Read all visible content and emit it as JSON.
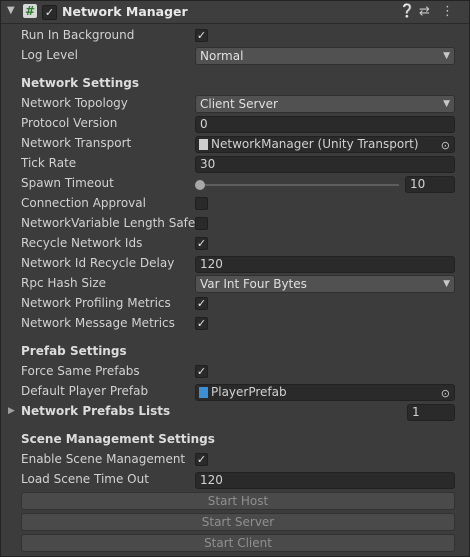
{
  "header": {
    "title": "Network Manager",
    "component_icon": "network-manager-icon",
    "enabled": true,
    "icons": [
      "help-icon",
      "preset-icon",
      "more-menu-icon"
    ]
  },
  "fields": {
    "run_in_background": {
      "label": "Run In Background",
      "checked": true
    },
    "log_level": {
      "label": "Log Level",
      "value": "Normal"
    }
  },
  "network_settings": {
    "heading": "Network Settings",
    "topology": {
      "label": "Network Topology",
      "value": "Client Server"
    },
    "protocol_version": {
      "label": "Protocol Version",
      "value": "0"
    },
    "transport": {
      "label": "Network Transport",
      "value": "NetworkManager (Unity Transport)"
    },
    "tick_rate": {
      "label": "Tick Rate",
      "value": "30"
    },
    "spawn_timeout": {
      "label": "Spawn Timeout",
      "value": "10"
    },
    "connection_approval": {
      "label": "Connection Approval",
      "checked": false
    },
    "nv_length_safety": {
      "label": "NetworkVariable Length Safety",
      "checked": false
    },
    "recycle_ids": {
      "label": "Recycle Network Ids",
      "checked": true
    },
    "recycle_delay": {
      "label": "Network Id Recycle Delay",
      "value": "120"
    },
    "rpc_hash_size": {
      "label": "Rpc Hash Size",
      "value": "Var Int Four Bytes"
    },
    "profiling_metrics": {
      "label": "Network Profiling Metrics",
      "checked": true
    },
    "message_metrics": {
      "label": "Network Message Metrics",
      "checked": true
    }
  },
  "prefab_settings": {
    "heading": "Prefab Settings",
    "force_same": {
      "label": "Force Same Prefabs",
      "checked": true
    },
    "default_player": {
      "label": "Default Player Prefab",
      "value": "PlayerPrefab"
    },
    "prefab_lists": {
      "label": "Network Prefabs Lists",
      "count": "1"
    }
  },
  "scene_settings": {
    "heading": "Scene Management Settings",
    "enable": {
      "label": "Enable Scene Management",
      "checked": true
    },
    "load_timeout": {
      "label": "Load Scene Time Out",
      "value": "120"
    }
  },
  "buttons": {
    "start_host": "Start Host",
    "start_server": "Start Server",
    "start_client": "Start Client"
  },
  "glyphs": {
    "check": "✓",
    "dropdown": "▼",
    "picker": "⊙",
    "fold_open": "▼",
    "fold_closed": "▶"
  }
}
